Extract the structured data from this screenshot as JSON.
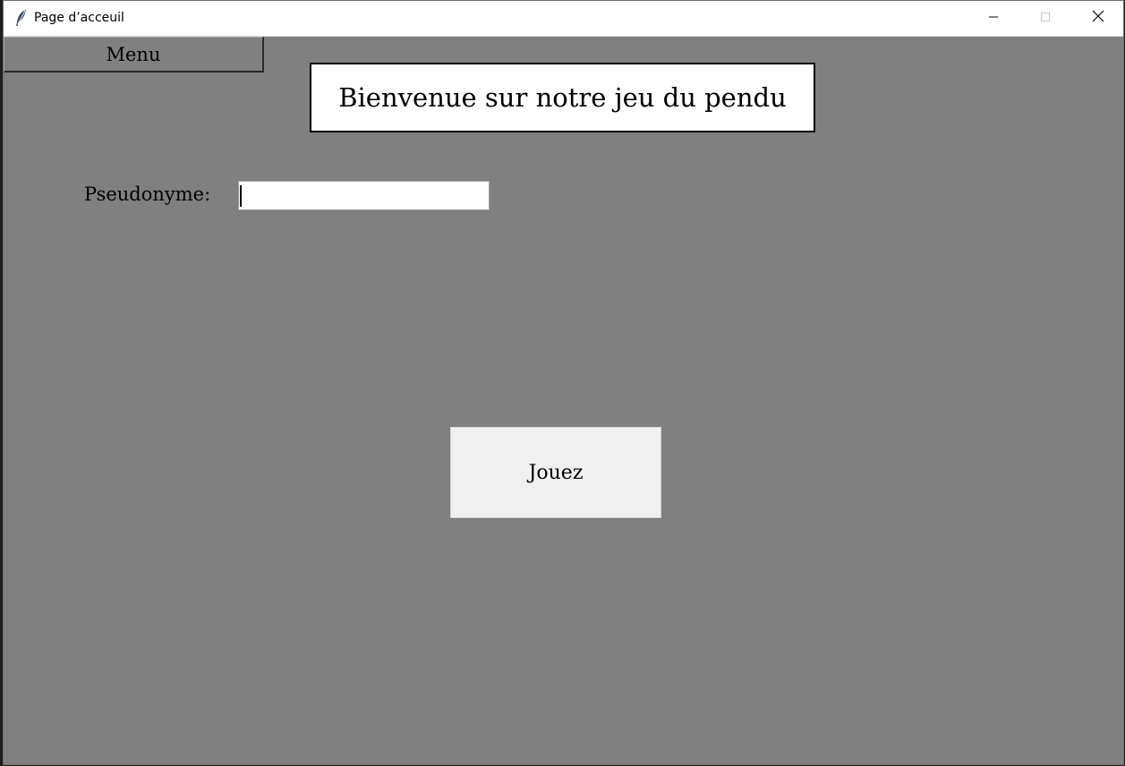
{
  "window": {
    "title": "Page d’acceuil"
  },
  "menu": {
    "label": "Menu"
  },
  "banner": {
    "text": "Bienvenue sur notre jeu du pendu"
  },
  "form": {
    "pseudo_label": "Pseudonyme:",
    "pseudo_value": ""
  },
  "actions": {
    "play_label": "Jouez"
  },
  "colors": {
    "window_background": "#808080",
    "button_background": "#f0f0f0",
    "banner_background": "#ffffff"
  },
  "icons": {
    "app": "feather-icon",
    "minimize": "minimize-icon",
    "maximize": "maximize-icon",
    "close": "close-icon"
  }
}
